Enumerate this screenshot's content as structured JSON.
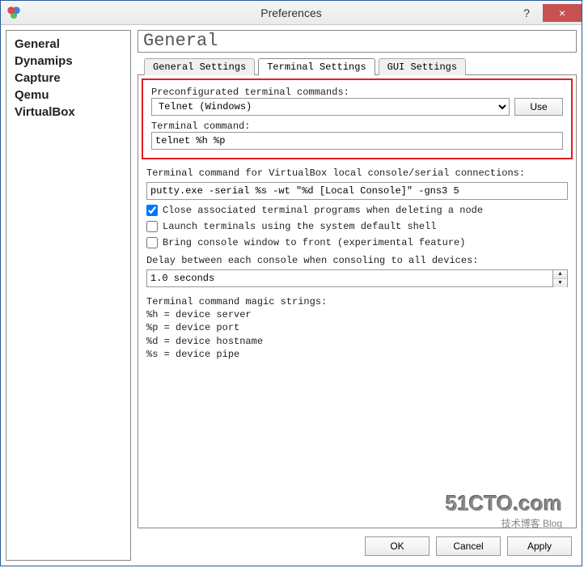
{
  "window": {
    "title": "Preferences",
    "help_tooltip": "?",
    "close_tooltip": "×"
  },
  "sidebar": {
    "items": [
      {
        "label": "General"
      },
      {
        "label": "Dynamips"
      },
      {
        "label": "Capture"
      },
      {
        "label": "Qemu"
      },
      {
        "label": "VirtualBox"
      }
    ]
  },
  "page": {
    "header": "General",
    "tabs": [
      {
        "label": "General Settings",
        "active": false
      },
      {
        "label": "Terminal Settings",
        "active": true
      },
      {
        "label": "GUI Settings",
        "active": false
      }
    ]
  },
  "terminal": {
    "preconf_label": "Preconfigurated terminal commands:",
    "preconf_value": "Telnet (Windows)",
    "use_btn": "Use",
    "cmd_label": "Terminal command:",
    "cmd_value": "telnet %h %p",
    "vbox_label": "Terminal command for VirtualBox local console/serial connections:",
    "vbox_value": "putty.exe -serial %s -wt \"%d [Local Console]\" -gns3 5",
    "chk1": "Close associated terminal programs when deleting a node",
    "chk1_checked": true,
    "chk2": "Launch terminals using the system default shell",
    "chk2_checked": false,
    "chk3": "Bring console window to front (experimental feature)",
    "chk3_checked": false,
    "delay_label": "Delay between each console when consoling to all devices:",
    "delay_value": "1.0 seconds",
    "magic_title": "Terminal command magic strings:",
    "magic_h": "%h = device server",
    "magic_p": "%p = device port",
    "magic_d": "%d = device hostname",
    "magic_s": "%s = device pipe"
  },
  "footer": {
    "ok": "OK",
    "cancel": "Cancel",
    "apply": "Apply"
  },
  "watermark": {
    "line1": "51CTO.com",
    "line2": "技术博客 Blog"
  }
}
